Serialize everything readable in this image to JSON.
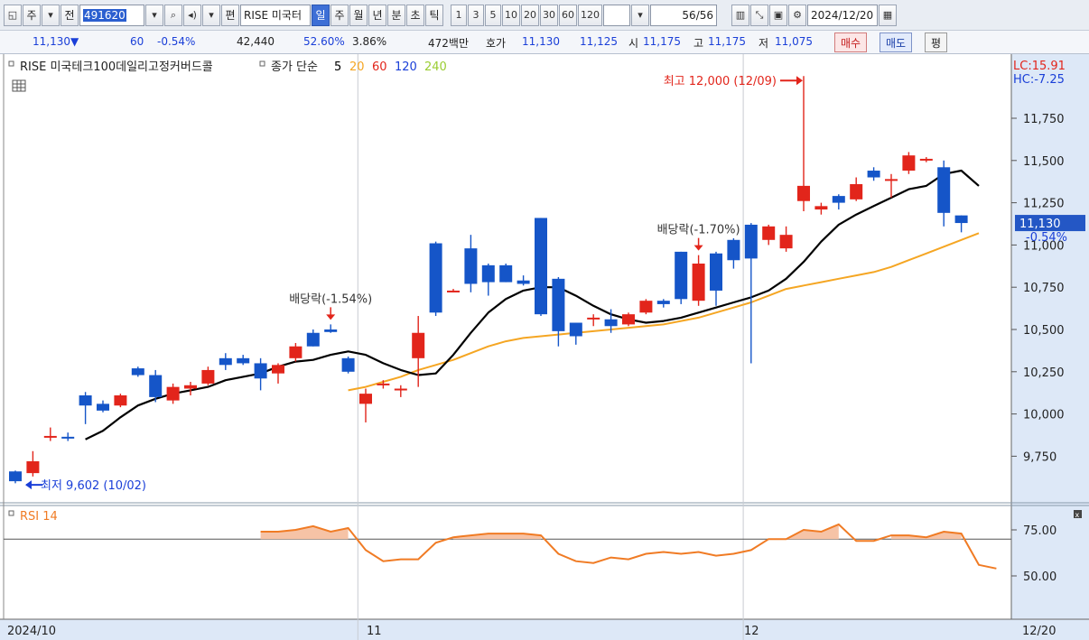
{
  "toolbar": {
    "period_type": "주",
    "prev_label": "전",
    "code": "491620",
    "edit_label": "편",
    "name_short": "RISE 미국터",
    "period_tabs": [
      "일",
      "주",
      "월",
      "년",
      "분",
      "초",
      "틱"
    ],
    "selected_tab": "일",
    "intervals": [
      "1",
      "3",
      "5",
      "10",
      "20",
      "30",
      "60",
      "120"
    ],
    "count": "56",
    "count_total": "/56",
    "date": "2024/12/20"
  },
  "quote": {
    "price": "11,130",
    "direction": "▼",
    "change": "60",
    "change_pct": "-0.54%",
    "volume": "42,440",
    "volume_ratio": "52.60%",
    "turnover": "3.86%",
    "amount": "472백만",
    "ask_label": "호가",
    "ask1": "11,130",
    "ask2": "11,125",
    "open_label": "시",
    "open": "11,175",
    "high_label": "고",
    "high": "11,175",
    "low_label": "저",
    "low": "11,075",
    "buy_label": "매수",
    "sell_label": "매도",
    "avg_label": "평"
  },
  "colors": {
    "up": "#e2251b",
    "down": "#1555c8",
    "ma5": "#000000",
    "ma20": "#f5a623",
    "ma60": "#e2251b",
    "ma120": "#1a3fd8",
    "ma240": "#9acd32",
    "rsi": "#f07b24",
    "price_tag": "#2457c5"
  },
  "chart_data": [
    {
      "type": "candlestick",
      "title": "RISE 미국테크100데일리고정커버드콜",
      "indicator_label": "종가 단순",
      "ma_periods": [
        "5",
        "20",
        "60",
        "120",
        "240"
      ],
      "price_axis": {
        "ticks": [
          "9,750",
          "10,000",
          "10,250",
          "10,500",
          "10,750",
          "11,000",
          "11,250",
          "11,500",
          "11,750"
        ],
        "lc_label": "LC:15.91",
        "hc_label": "HC:-7.25",
        "current_price": "11,130",
        "current_pct": "-0.54%"
      },
      "x_axis": {
        "labels": [
          "2024/10",
          "11",
          "12"
        ],
        "end_label": "12/20"
      },
      "candles": [
        {
          "o": 9660,
          "h": 9665,
          "l": 9590,
          "c": 9602
        },
        {
          "o": 9650,
          "h": 9780,
          "l": 9630,
          "c": 9720
        },
        {
          "o": 9870,
          "h": 9920,
          "l": 9840,
          "c": 9870
        },
        {
          "o": 9865,
          "h": 9890,
          "l": 9840,
          "c": 9860
        },
        {
          "o": 10110,
          "h": 10130,
          "l": 9940,
          "c": 10050
        },
        {
          "o": 10060,
          "h": 10080,
          "l": 10010,
          "c": 10020
        },
        {
          "o": 10050,
          "h": 10120,
          "l": 10040,
          "c": 10110
        },
        {
          "o": 10270,
          "h": 10280,
          "l": 10220,
          "c": 10230
        },
        {
          "o": 10230,
          "h": 10260,
          "l": 10070,
          "c": 10100
        },
        {
          "o": 10080,
          "h": 10180,
          "l": 10060,
          "c": 10160
        },
        {
          "o": 10150,
          "h": 10190,
          "l": 10110,
          "c": 10170
        },
        {
          "o": 10180,
          "h": 10280,
          "l": 10170,
          "c": 10260
        },
        {
          "o": 10330,
          "h": 10360,
          "l": 10260,
          "c": 10290
        },
        {
          "o": 10330,
          "h": 10350,
          "l": 10290,
          "c": 10300
        },
        {
          "o": 10300,
          "h": 10330,
          "l": 10140,
          "c": 10210
        },
        {
          "o": 10240,
          "h": 10300,
          "l": 10180,
          "c": 10290
        },
        {
          "o": 10330,
          "h": 10420,
          "l": 10310,
          "c": 10400
        },
        {
          "o": 10480,
          "h": 10500,
          "l": 10400,
          "c": 10400
        },
        {
          "o": 10500,
          "h": 10530,
          "l": 10480,
          "c": 10485
        },
        {
          "o": 10330,
          "h": 10340,
          "l": 10240,
          "c": 10250
        },
        {
          "o": 10060,
          "h": 10150,
          "l": 9950,
          "c": 10120
        },
        {
          "o": 10180,
          "h": 10200,
          "l": 10150,
          "c": 10180
        },
        {
          "o": 10140,
          "h": 10170,
          "l": 10100,
          "c": 10150
        },
        {
          "o": 10330,
          "h": 10580,
          "l": 10160,
          "c": 10480
        },
        {
          "o": 11010,
          "h": 11020,
          "l": 10580,
          "c": 10600
        },
        {
          "o": 10730,
          "h": 10740,
          "l": 10720,
          "c": 10730
        },
        {
          "o": 10980,
          "h": 11060,
          "l": 10720,
          "c": 10770
        },
        {
          "o": 10880,
          "h": 10890,
          "l": 10700,
          "c": 10780
        },
        {
          "o": 10880,
          "h": 10890,
          "l": 10780,
          "c": 10780
        },
        {
          "o": 10790,
          "h": 10820,
          "l": 10760,
          "c": 10770
        },
        {
          "o": 11160,
          "h": 11160,
          "l": 10580,
          "c": 10590
        },
        {
          "o": 10800,
          "h": 10810,
          "l": 10400,
          "c": 10490
        },
        {
          "o": 10540,
          "h": 10540,
          "l": 10410,
          "c": 10460
        },
        {
          "o": 10560,
          "h": 10590,
          "l": 10520,
          "c": 10570
        },
        {
          "o": 10560,
          "h": 10620,
          "l": 10480,
          "c": 10520
        },
        {
          "o": 10530,
          "h": 10600,
          "l": 10520,
          "c": 10590
        },
        {
          "o": 10600,
          "h": 10680,
          "l": 10590,
          "c": 10670
        },
        {
          "o": 10670,
          "h": 10680,
          "l": 10630,
          "c": 10650
        },
        {
          "o": 10960,
          "h": 10960,
          "l": 10650,
          "c": 10680
        },
        {
          "o": 10670,
          "h": 10940,
          "l": 10640,
          "c": 10890
        },
        {
          "o": 10950,
          "h": 10960,
          "l": 10640,
          "c": 10730
        },
        {
          "o": 11030,
          "h": 11040,
          "l": 10860,
          "c": 10910
        },
        {
          "o": 11120,
          "h": 11130,
          "l": 10300,
          "c": 10920
        },
        {
          "o": 11030,
          "h": 11120,
          "l": 11000,
          "c": 11110
        },
        {
          "o": 10980,
          "h": 11110,
          "l": 10960,
          "c": 11060
        },
        {
          "o": 11260,
          "h": 12000,
          "l": 11200,
          "c": 11350
        },
        {
          "o": 11210,
          "h": 11250,
          "l": 11180,
          "c": 11230
        },
        {
          "o": 11290,
          "h": 11300,
          "l": 11210,
          "c": 11250
        },
        {
          "o": 11270,
          "h": 11400,
          "l": 11260,
          "c": 11360
        },
        {
          "o": 11440,
          "h": 11460,
          "l": 11380,
          "c": 11400
        },
        {
          "o": 11390,
          "h": 11420,
          "l": 11280,
          "c": 11390
        },
        {
          "o": 11440,
          "h": 11550,
          "l": 11420,
          "c": 11530
        },
        {
          "o": 11500,
          "h": 11520,
          "l": 11490,
          "c": 11510
        },
        {
          "o": 11460,
          "h": 11500,
          "l": 11110,
          "c": 11190
        },
        {
          "o": 11175,
          "h": 11175,
          "l": 11075,
          "c": 11130
        }
      ],
      "ma5": [
        null,
        null,
        null,
        null,
        9850,
        9900,
        9980,
        10050,
        10090,
        10120,
        10140,
        10160,
        10200,
        10220,
        10240,
        10280,
        10310,
        10320,
        10350,
        10370,
        10350,
        10300,
        10260,
        10230,
        10240,
        10350,
        10480,
        10600,
        10680,
        10730,
        10750,
        10750,
        10700,
        10640,
        10590,
        10560,
        10540,
        10550,
        10570,
        10600,
        10630,
        10660,
        10690,
        10730,
        10800,
        10900,
        11020,
        11120,
        11180,
        11230,
        11280,
        11330,
        11350,
        11420,
        11440,
        11350
      ],
      "ma20": [
        null,
        null,
        null,
        null,
        null,
        null,
        null,
        null,
        null,
        null,
        null,
        null,
        null,
        null,
        null,
        null,
        null,
        null,
        null,
        10140,
        10160,
        10190,
        10220,
        10260,
        10290,
        10320,
        10360,
        10400,
        10430,
        10450,
        10460,
        10470,
        10480,
        10490,
        10500,
        10510,
        10520,
        10530,
        10550,
        10570,
        10600,
        10630,
        10660,
        10700,
        10740,
        10760,
        10780,
        10800,
        10820,
        10840,
        10870,
        10910,
        10950,
        10990,
        11030,
        11070
      ],
      "annotations": {
        "high": {
          "label": "최고 12,000 (12/09)",
          "index": 45,
          "value": 12000
        },
        "low": {
          "label": "최저 9,602 (10/02)",
          "index": 0,
          "value": 9602
        },
        "dividends": [
          {
            "label": "배당락(-1.54%)",
            "index": 18
          },
          {
            "label": "배당락(-1.70%)",
            "index": 39
          }
        ]
      }
    },
    {
      "type": "line",
      "title": "RSI 14",
      "y_ticks": [
        "75.00",
        "50.00"
      ],
      "levels": [
        70,
        30
      ],
      "values": [
        null,
        null,
        null,
        null,
        null,
        null,
        null,
        null,
        null,
        null,
        null,
        null,
        null,
        null,
        74,
        74,
        75,
        77,
        74,
        76,
        64,
        58,
        59,
        59,
        68,
        71,
        72,
        73,
        73,
        73,
        72,
        62,
        58,
        57,
        60,
        59,
        62,
        63,
        62,
        63,
        61,
        62,
        64,
        70,
        70,
        75,
        74,
        78,
        69,
        69,
        72,
        72,
        71,
        74,
        73,
        56,
        54
      ]
    }
  ]
}
